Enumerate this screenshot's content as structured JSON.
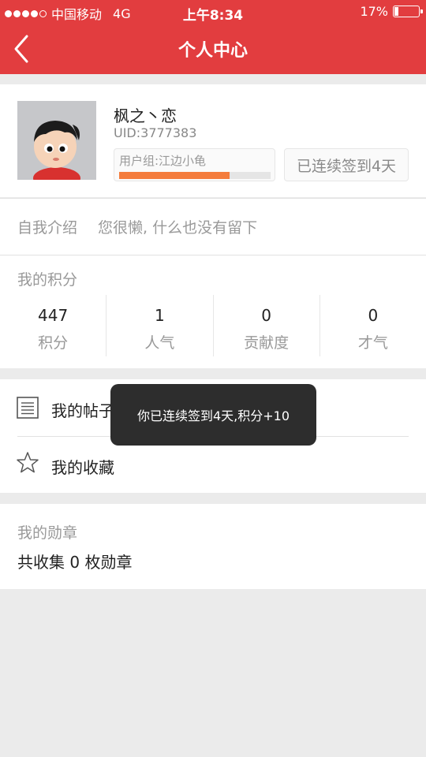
{
  "status_bar": {
    "carrier": "中国移动",
    "network": "4G",
    "time": "上午8:34",
    "battery": "17%"
  },
  "header": {
    "title": "个人中心"
  },
  "profile": {
    "username": "枫之丶恋",
    "uid": "UID:3777383",
    "group": "用户组:江边小龟",
    "group_progress": 0.73,
    "signin_text": "已连续签到4天"
  },
  "intro": {
    "label": "自我介绍",
    "text": "您很懒, 什么也没有留下"
  },
  "points": {
    "title": "我的积分",
    "stats": [
      {
        "value": "447",
        "label": "积分"
      },
      {
        "value": "1",
        "label": "人气"
      },
      {
        "value": "0",
        "label": "贡献度"
      },
      {
        "value": "0",
        "label": "才气"
      }
    ]
  },
  "menu": {
    "posts": "我的帖子",
    "favorites": "我的收藏"
  },
  "medals": {
    "title": "我的勋章",
    "count_text": "共收集 0 枚勋章"
  },
  "toast": {
    "message": "你已连续签到4天,积分+10"
  },
  "colors": {
    "brand": "#e23d3f",
    "progress": "#f47c3c"
  }
}
